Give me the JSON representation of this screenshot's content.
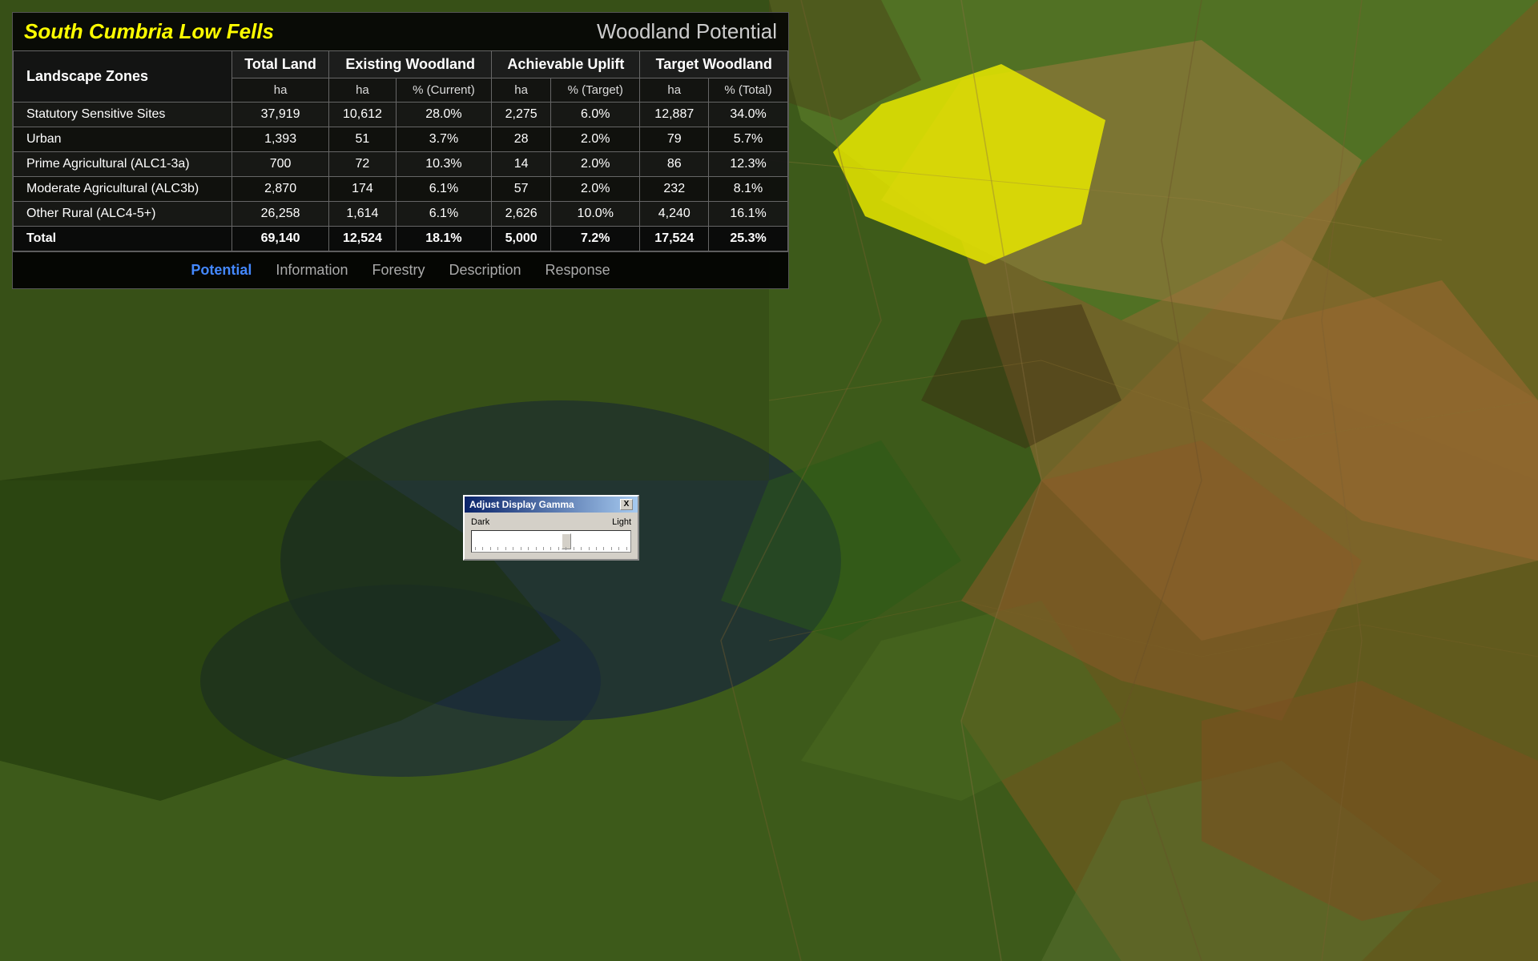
{
  "header": {
    "title": "South Cumbria Low Fells",
    "subtitle": "Woodland Potential"
  },
  "table": {
    "columns": {
      "landscape_zones": "Landscape Zones",
      "total_land": "Total Land",
      "existing_woodland": "Existing Woodland",
      "achievable_uplift": "Achievable Uplift",
      "target_woodland": "Target Woodland"
    },
    "subheaders": {
      "total_land_unit": "ha",
      "existing_ha": "ha",
      "existing_pct": "% (Current)",
      "achievable_ha": "ha",
      "achievable_pct": "% (Target)",
      "target_ha": "ha",
      "target_pct": "% (Total)"
    },
    "rows": [
      {
        "zone": "Statutory Sensitive Sites",
        "total_ha": "37,919",
        "exist_ha": "10,612",
        "exist_pct": "28.0%",
        "achiev_ha": "2,275",
        "achiev_pct": "6.0%",
        "target_ha": "12,887",
        "target_pct": "34.0%"
      },
      {
        "zone": "Urban",
        "total_ha": "1,393",
        "exist_ha": "51",
        "exist_pct": "3.7%",
        "achiev_ha": "28",
        "achiev_pct": "2.0%",
        "target_ha": "79",
        "target_pct": "5.7%"
      },
      {
        "zone": "Prime Agricultural (ALC1-3a)",
        "total_ha": "700",
        "exist_ha": "72",
        "exist_pct": "10.3%",
        "achiev_ha": "14",
        "achiev_pct": "2.0%",
        "target_ha": "86",
        "target_pct": "12.3%"
      },
      {
        "zone": "Moderate Agricultural (ALC3b)",
        "total_ha": "2,870",
        "exist_ha": "174",
        "exist_pct": "6.1%",
        "achiev_ha": "57",
        "achiev_pct": "2.0%",
        "target_ha": "232",
        "target_pct": "8.1%"
      },
      {
        "zone": "Other Rural (ALC4-5+)",
        "total_ha": "26,258",
        "exist_ha": "1,614",
        "exist_pct": "6.1%",
        "achiev_ha": "2,626",
        "achiev_pct": "10.0%",
        "target_ha": "4,240",
        "target_pct": "16.1%"
      }
    ],
    "total_row": {
      "zone": "Total",
      "total_ha": "69,140",
      "exist_ha": "12,524",
      "exist_pct": "18.1%",
      "achiev_ha": "5,000",
      "achiev_pct": "7.2%",
      "target_ha": "17,524",
      "target_pct": "25.3%"
    }
  },
  "tabs": [
    {
      "label": "Potential",
      "active": true
    },
    {
      "label": "Information",
      "active": false
    },
    {
      "label": "Forestry",
      "active": false
    },
    {
      "label": "Description",
      "active": false
    },
    {
      "label": "Response",
      "active": false
    }
  ],
  "gamma_dialog": {
    "title": "Adjust Display Gamma",
    "dark_label": "Dark",
    "light_label": "Light",
    "close_label": "X",
    "slider_value": 60
  }
}
